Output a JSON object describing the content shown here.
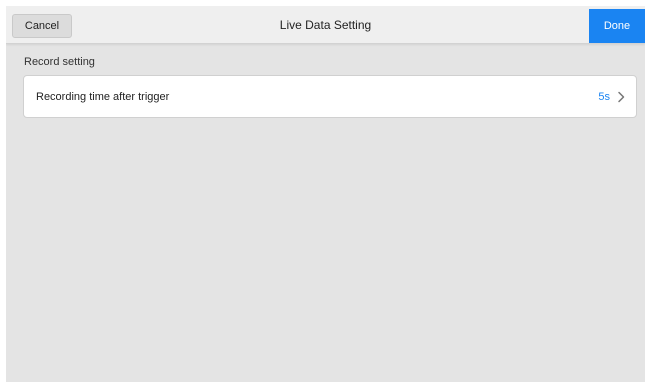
{
  "header": {
    "cancel_label": "Cancel",
    "title": "Live Data Setting",
    "done_label": "Done"
  },
  "section": {
    "label": "Record setting",
    "items": [
      {
        "label": "Recording time after trigger",
        "value": "5s",
        "icon": "chevron-right-icon"
      }
    ]
  },
  "colors": {
    "accent": "#1a84f2",
    "background": "#e4e4e4",
    "header": "#efefef",
    "row": "#ffffff"
  }
}
